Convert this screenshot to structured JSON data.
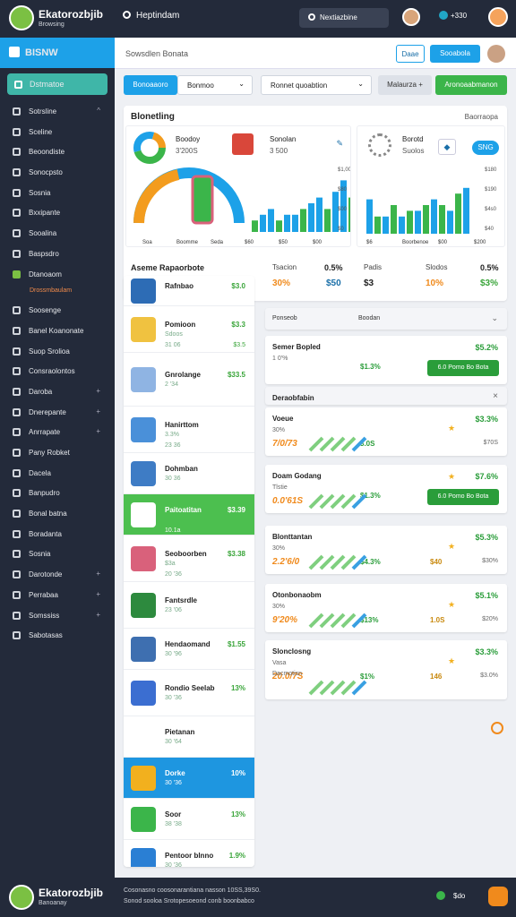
{
  "app": {
    "name": "Ekatorozbjib",
    "subtitle": "Browsing"
  },
  "topbar": {
    "search_label": "Heptindam",
    "search2_label": "Nextiazbine",
    "stat": "+330"
  },
  "sidebar": {
    "header": "BISNW",
    "active_item": "Dstmatoe",
    "items": [
      {
        "label": "Sotrsline",
        "chevron": "^"
      },
      {
        "label": "Sceline"
      },
      {
        "label": "Beoondiste"
      },
      {
        "label": "Sonocpsto"
      },
      {
        "label": "Sosnia"
      },
      {
        "label": "Bxxipante"
      },
      {
        "label": "Sooalina"
      },
      {
        "label": "Baspsdro"
      },
      {
        "label": "Dtanoaom"
      }
    ],
    "sub_item": "Drossmbaulam",
    "items2": [
      {
        "label": "Soosenge"
      },
      {
        "label": "Banel Koanonate"
      },
      {
        "label": "Suop Srolioa"
      },
      {
        "label": "Consraolontos"
      },
      {
        "label": "Daroba",
        "chevron": "+"
      },
      {
        "label": "Dnerepante",
        "chevron": "+"
      },
      {
        "label": "Anrrapate",
        "chevron": "+"
      },
      {
        "label": "Pany Robket"
      },
      {
        "label": "Dacela"
      },
      {
        "label": "Banpudro"
      },
      {
        "label": "Bonal batna"
      },
      {
        "label": "Boradanta"
      },
      {
        "label": "Sosnia"
      },
      {
        "label": "Darotonde",
        "chevron": "+"
      },
      {
        "label": "Perrabaa",
        "chevron": "+"
      },
      {
        "label": "Somssiss",
        "chevron": "+"
      },
      {
        "label": "Sabotasas"
      }
    ]
  },
  "breadcrumb": {
    "text": "Sowsdlen Bonata",
    "btn1": "Daae",
    "btn2": "Sooabola"
  },
  "toolbar": {
    "tab_active": "Bonoaaoro",
    "select1": "Bonmoo",
    "select2": "Ronnet quoabtion",
    "select3": "Malaurza +",
    "action": "Aronoaabmanon"
  },
  "panel": {
    "title": "Blonetling",
    "right_label": "Baorraopa",
    "w1": {
      "label": "Boodoy",
      "value": "3'200S",
      "title2": "Sonolan",
      "value2": "3 500"
    },
    "w2": {
      "label": "Borotd",
      "value": "Suolos",
      "btn": "SNG"
    },
    "gauge_labels": [
      "Soa",
      "Boomme",
      "Seda"
    ],
    "chart_data": [
      {
        "type": "bar",
        "categories": [
          "Soa",
          "Boomme",
          "Seda"
        ],
        "values": [
          2,
          3,
          4,
          2,
          3,
          3,
          4,
          5,
          6,
          4,
          7,
          9,
          6
        ],
        "ylabel": "",
        "yticks": [
          "$1,00",
          "$80",
          "$00",
          "$0"
        ],
        "xticks": [
          "Soa",
          "Boomme",
          "Seda",
          "$60",
          "$50",
          "$00"
        ]
      },
      {
        "type": "bar",
        "categories": [
          "$6",
          "Boorbenoe",
          "$00",
          "$200"
        ],
        "values": [
          6,
          3,
          3,
          5,
          3,
          4,
          4,
          5,
          6,
          5,
          4,
          7,
          8
        ],
        "yticks": [
          "$180",
          "$190",
          "$4s0",
          "$40"
        ],
        "xticks": [
          "$6",
          "Boorbenoe",
          "$00",
          "$200"
        ]
      }
    ],
    "stats_title": "Aseme Rapaorbote",
    "stats": [
      {
        "label": "Tsacion",
        "value": "0.5%",
        "sub": "30%",
        "sub2": "$50"
      },
      {
        "label": "Padis",
        "value": "Slodos",
        "v2": "0.5%",
        "sub": "$3",
        "sub2": "10%",
        "sub3": "$3%"
      }
    ]
  },
  "left_list": [
    {
      "title": "Rafnbao",
      "sub": "",
      "val": "$3.0"
    },
    {
      "title": "Pomioon",
      "sub": "Sdoos",
      "val": "$3.3",
      "sub2": "31 06",
      "val2": "$3.5"
    },
    {
      "title": "Gnrolange",
      "sub": "2 '34",
      "val": "$33.5"
    },
    {
      "title": "Hanirttom",
      "sub": "3.3%",
      "val": "",
      "sub2": "23 36"
    },
    {
      "title": "Dohmban",
      "sub": "30 36",
      "val": ""
    },
    {
      "title": "Paitoatitan",
      "sub": "",
      "val": "$3.39",
      "sub2": "10.1a"
    },
    {
      "title": "Seoboorben",
      "sub": "$3a",
      "val": "$3.38",
      "sub2": "20 '36"
    },
    {
      "title": "Fantsrdle",
      "sub": "23 '06",
      "val": ""
    },
    {
      "title": "Hendaomand",
      "sub": "30 '96",
      "val": "$1.55"
    },
    {
      "title": "Rondio Seelab",
      "sub": "30 '36",
      "val": "13%"
    },
    {
      "title": "Pietanan",
      "sub": "30 '64",
      "val": ""
    },
    {
      "title": "Dorke",
      "sub": "30 '36",
      "val": "10%"
    },
    {
      "title": "Soor",
      "sub": "38 '38",
      "val": "13%"
    },
    {
      "title": "Pentoor blnno",
      "sub": "30 '36",
      "val": "1.9%"
    }
  ],
  "right_header": {
    "col1": "Ponseob",
    "col2": "Boodan"
  },
  "right_cards": [
    {
      "title": "Semer Bopled",
      "val": "$5.2%",
      "sub": "1 0'%",
      "mid": "$1.3%",
      "pill": "6.0 Pomo Bo Bota"
    },
    {
      "title": "Deraobfabin",
      "close": "×"
    },
    {
      "title": "Voeue",
      "val": "$3.3%",
      "sub": "30%",
      "big": "7/0/73",
      "mid": "3.0S",
      "small": "$70S"
    },
    {
      "title": "Doam Godang",
      "val": "$7.6%",
      "sub": "Tlstie",
      "big": "0.0'61S",
      "mid": "$1.3%",
      "pill": "6.0 Pomo Bo Bota"
    },
    {
      "title": "Blonttantan",
      "val": "$5.3%",
      "sub": "30%",
      "big": "2.2'6/0",
      "mid": "$4.3%",
      "mid2": "$40",
      "small": "$30%"
    },
    {
      "title": "Otonbonaobm",
      "val": "$5.1%",
      "sub": "30%",
      "big": "9'20%",
      "mid": "$13%",
      "mid2": "1.0S",
      "small": "$20%"
    },
    {
      "title": "Slonclosng",
      "val": "$3.3%",
      "sub": "Vasa",
      "big": "20.0/7S",
      "mid": "$1%",
      "mid2": "146",
      "small": "$3.0%",
      "sub2": "Dacmotisn"
    }
  ],
  "footer": {
    "brand": "Ekatorozbjib",
    "sub": "Banoanay",
    "text1": "Cosonasno coosonarantiana nasson 10SS,39S0.",
    "text2": "Sonod sooloa Srotopesoeond conb boonbabco",
    "status": "$do"
  }
}
